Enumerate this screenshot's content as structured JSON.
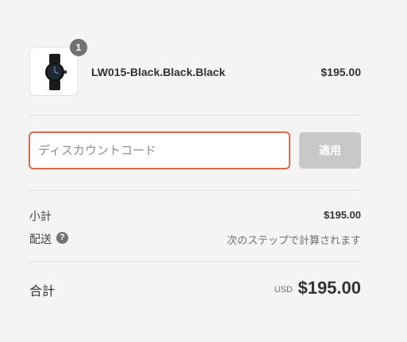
{
  "product": {
    "quantity": "1",
    "name": "LW015-Black.Black.Black",
    "price": "$195.00",
    "image_icon": "watch-icon"
  },
  "discount": {
    "placeholder": "ディスカウントコード",
    "apply_label": "適用"
  },
  "summary": {
    "subtotal_label": "小計",
    "subtotal_value": "$195.00",
    "shipping_label": "配送",
    "shipping_help": "?",
    "shipping_value": "次のステップで計算されます"
  },
  "total": {
    "label": "合計",
    "currency": "USD",
    "amount": "$195.00"
  },
  "colors": {
    "background": "#f4f4f4",
    "input_focus_border": "#e0684b",
    "button_disabled": "#c8c8c8",
    "badge": "#727272"
  }
}
